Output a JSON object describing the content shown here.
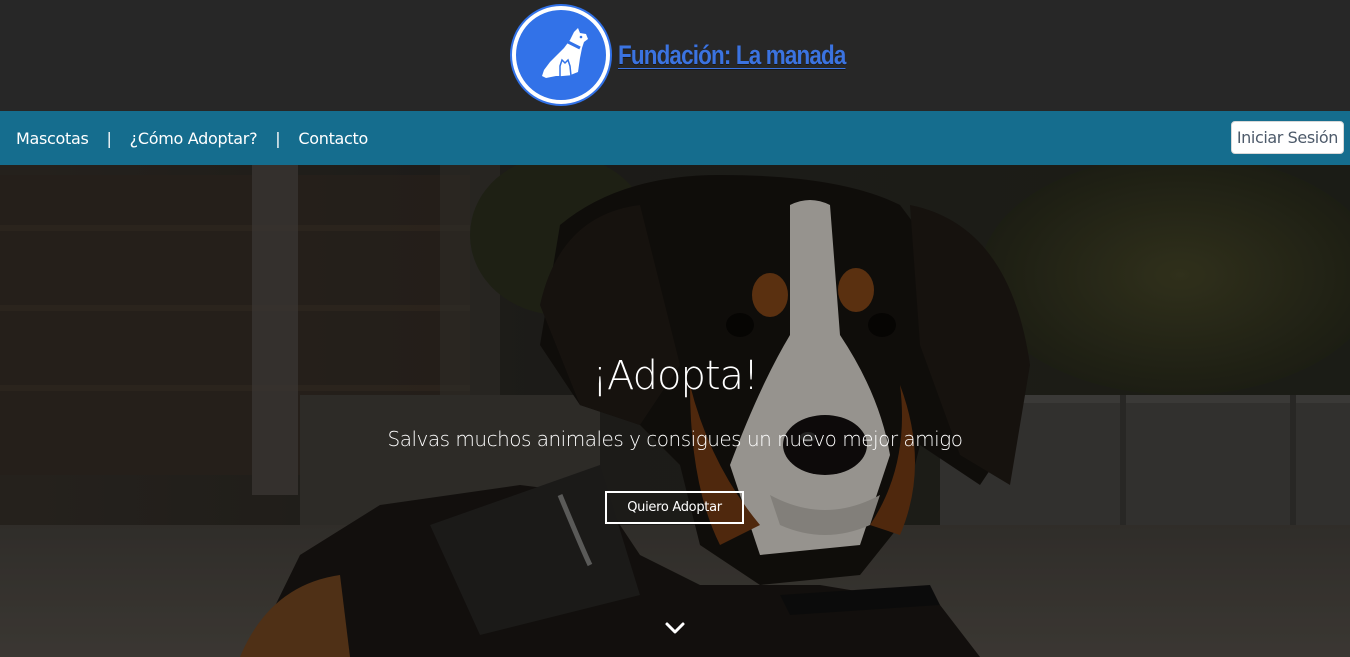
{
  "header": {
    "logo_icon": "dog-and-cat-logo-icon",
    "brand_name": "Fundación: La manada",
    "brand_color": "#3b73e0"
  },
  "nav": {
    "links": [
      {
        "label": "Mascotas"
      },
      {
        "label": "¿Cómo Adoptar?"
      },
      {
        "label": "Contacto"
      }
    ],
    "separator": "|",
    "login_label": "Iniciar Sesión",
    "bar_color": "#156d8e"
  },
  "hero": {
    "image": "dog-photo",
    "title": "¡Adopta!",
    "subtitle": "Salvas muchos animales y consigues un nuevo mejor amigo",
    "cta_label": "Quiero Adoptar",
    "scroll_icon": "chevron-down-icon"
  }
}
